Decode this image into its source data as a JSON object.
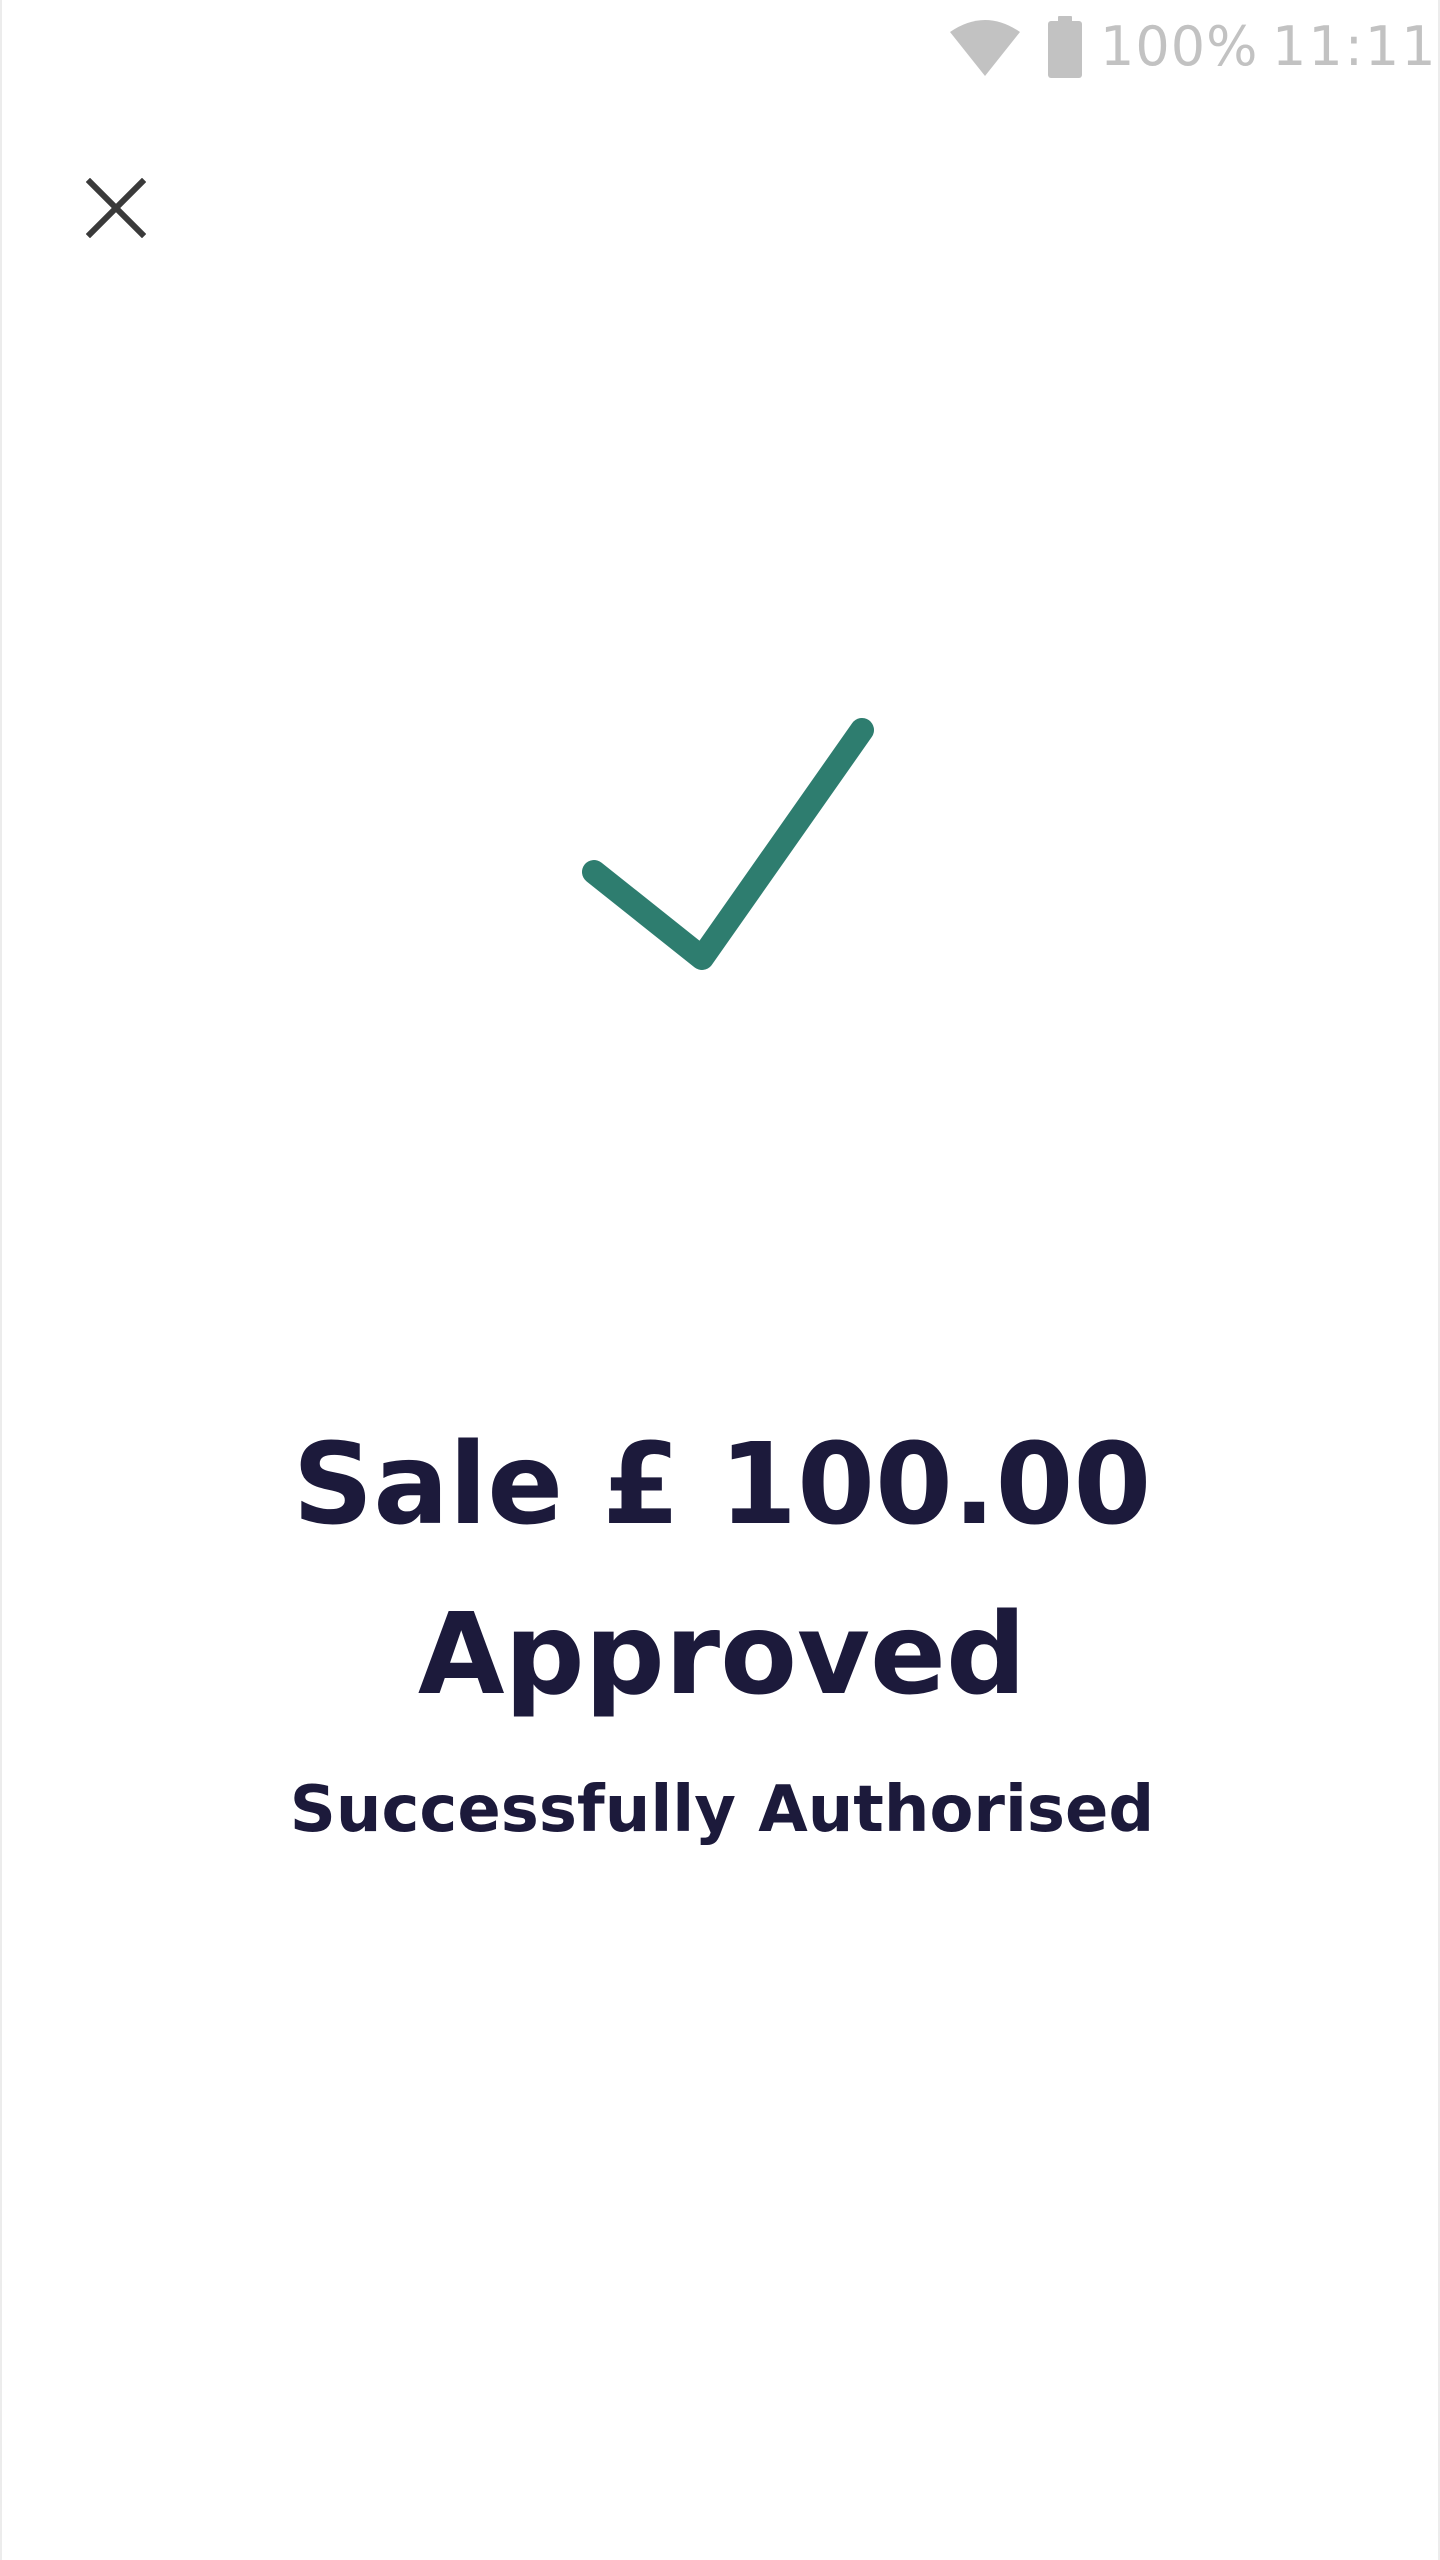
{
  "status_bar": {
    "wifi_icon": "wifi-icon",
    "battery_icon": "battery-icon",
    "battery_level": "100%",
    "battery_percent": 100,
    "time": "11:11"
  },
  "header": {
    "close_icon": "close-icon"
  },
  "result": {
    "status_icon": "checkmark-icon",
    "sale_amount": "Sale £ 100.00",
    "status": "Approved",
    "message": "Successfully Authorised"
  },
  "colors": {
    "accent": "#2e7d6f",
    "text": "#1c1a3b",
    "status_text": "#c2c2c2"
  }
}
